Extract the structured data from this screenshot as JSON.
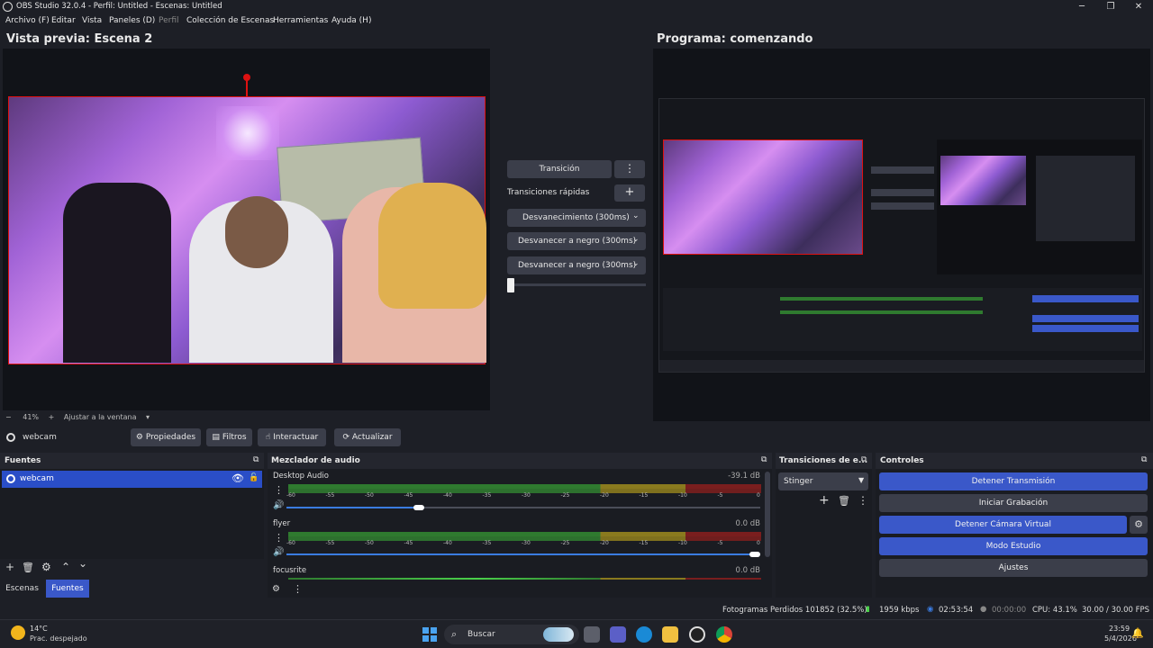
{
  "window": {
    "title": "OBS Studio 32.0.4 - Perfil: Untitled - Escenas: Untitled",
    "controls": [
      "─",
      "❐",
      "✕"
    ]
  },
  "menu": [
    "Archivo (F)",
    "Editar",
    "Vista",
    "Paneles (D)",
    "Perfil",
    "Colección de Escenas",
    "Herramientas",
    "Ayuda (H)"
  ],
  "preview": {
    "title": "Vista previa: Escena 2"
  },
  "program": {
    "title": "Programa: comenzando"
  },
  "transition_panel": {
    "transition_label": "Transición",
    "quick_label": "Transiciones rápidas",
    "items": [
      "Desvanecimiento (300ms)",
      "Desvanecer a negro (300ms)",
      "Desvanecer a negro (300ms)"
    ]
  },
  "zoom": {
    "minus": "−",
    "value": "41%",
    "plus": "+",
    "fit": "Ajustar a la ventana"
  },
  "source_toolbar": {
    "source_name": "webcam",
    "buttons": [
      "Propiedades",
      "Filtros",
      "Interactuar",
      "Actualizar"
    ]
  },
  "sources": {
    "title": "Fuentes",
    "items": [
      "webcam"
    ],
    "tabs": [
      "Escenas",
      "Fuentes"
    ]
  },
  "mixer": {
    "title": "Mezclador de audio",
    "ticks": [
      "-60",
      "-55",
      "-50",
      "-45",
      "-40",
      "-35",
      "-30",
      "-25",
      "-20",
      "-15",
      "-10",
      "-5",
      "0"
    ],
    "channels": [
      {
        "name": "Desktop Audio",
        "db": "-39.1 dB",
        "volume": 0.29
      },
      {
        "name": "flyer",
        "db": "0.0 dB",
        "volume": 1.0
      },
      {
        "name": "focusrite",
        "db": "0.0 dB",
        "volume": 1.0
      }
    ]
  },
  "transitions_dock": {
    "title": "Transiciones de e...",
    "selected": "Stinger"
  },
  "controls": {
    "title": "Controles",
    "buttons": [
      "Detener Transmisión",
      "Iniciar Grabación",
      "Detener Cámara Virtual",
      "Modo Estudio",
      "Ajustes"
    ]
  },
  "status": {
    "dropped": "Fotogramas Perdidos 101852 (32.5%)",
    "bitrate": "1959 kbps",
    "stream_time": "02:53:54",
    "rec_time": "00:00:00",
    "cpu": "CPU: 43.1%",
    "fps": "30.00 / 30.00 FPS"
  },
  "taskbar": {
    "weather_temp": "14°C",
    "weather_desc": "Prac. despejado",
    "search": "Buscar",
    "time": "23:59",
    "date": "5/4/2026"
  },
  "colors": {
    "accent": "#3a58c9",
    "selection": "#2a4ec7",
    "bg": "#1d1f26"
  }
}
